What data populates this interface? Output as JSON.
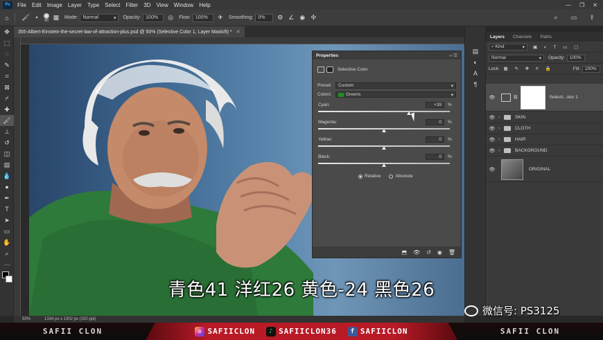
{
  "menu": {
    "app_icon": "Ps",
    "items": [
      "File",
      "Edit",
      "Image",
      "Layer",
      "Type",
      "Select",
      "Filter",
      "3D",
      "View",
      "Window",
      "Help"
    ]
  },
  "options_bar": {
    "brush_size": "80",
    "mode_label": "Mode:",
    "mode_value": "Normal",
    "opacity_label": "Opacity:",
    "opacity_value": "100%",
    "flow_label": "Flow:",
    "flow_value": "100%",
    "smoothing_label": "Smoothing:",
    "smoothing_value": "0%"
  },
  "document": {
    "tab_title": "355-Albert-Einstein-the-secret-law-of-attraction-plus.psd @ 50% (Selective Color 1, Layer Mask/8) *",
    "zoom": "50%",
    "doc_info": "1334 px x 1302 px (150 ppi)"
  },
  "properties": {
    "title": "Properties",
    "adjustment_name": "Selective Color",
    "preset_label": "Preset:",
    "preset_value": "Custom",
    "colors_label": "Colors:",
    "colors_value": "Greens",
    "colors_swatch": "#1f8f1f",
    "sliders": [
      {
        "label": "Cyan:",
        "value": "+39",
        "unit": "%",
        "position": 0.69
      },
      {
        "label": "Magenta:",
        "value": "0",
        "unit": "%",
        "position": 0.5
      },
      {
        "label": "Yellow:",
        "value": "0",
        "unit": "%",
        "position": 0.5
      },
      {
        "label": "Black:",
        "value": "0",
        "unit": "%",
        "position": 0.5
      }
    ],
    "method_relative": "Relative",
    "method_absolute": "Absolute"
  },
  "layers_panel": {
    "tabs": [
      "Layers",
      "Channels",
      "Paths"
    ],
    "kind_label": "Kind",
    "blend_mode": "Normal",
    "opacity_label": "Opacity:",
    "opacity_value": "100%",
    "lock_label": "Lock:",
    "fill_label": "Fill:",
    "fill_value": "100%",
    "layers": [
      {
        "name": "Selecti...olor 1",
        "type": "adjustment"
      },
      {
        "name": "SKIN",
        "type": "group"
      },
      {
        "name": "CLOTH",
        "type": "group"
      },
      {
        "name": "HAIR",
        "type": "group"
      },
      {
        "name": "BACKGROUND",
        "type": "group"
      },
      {
        "name": "ORIGINAL",
        "type": "image"
      }
    ]
  },
  "overlay": {
    "subtitle": "青色41 洋红26 黄色-24 黑色26",
    "wechat": "微信号: PS3125"
  },
  "banner": {
    "left": "SAFII CLON",
    "instagram": "SAFIICLON",
    "tiktok": "SAFIICLON36",
    "facebook": "SAFIICLON",
    "right": "SAFII CLON",
    "accent_color": "#b81a26"
  }
}
